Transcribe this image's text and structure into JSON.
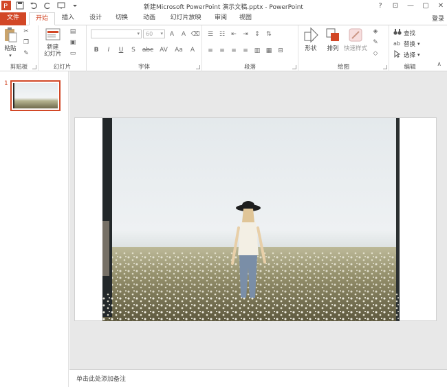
{
  "window": {
    "title": "新建Microsoft PowerPoint 演示文稿.pptx - PowerPoint",
    "controls": [
      "?",
      "⊡",
      "—",
      "▢",
      "✕"
    ]
  },
  "tabs": [
    {
      "label": "文件"
    },
    {
      "label": "开始"
    },
    {
      "label": "插入"
    },
    {
      "label": "设计"
    },
    {
      "label": "切换"
    },
    {
      "label": "动画"
    },
    {
      "label": "幻灯片放映"
    },
    {
      "label": "审阅"
    },
    {
      "label": "视图"
    }
  ],
  "login_label": "登录",
  "ribbon": {
    "clipboard": {
      "group_label": "剪贴板",
      "paste_label": "粘贴"
    },
    "slides": {
      "group_label": "幻灯片",
      "new_slide_label_1": "新建",
      "new_slide_label_2": "幻灯片"
    },
    "font": {
      "group_label": "字体",
      "font_size": "60",
      "format_labels": [
        "B",
        "I",
        "U",
        "S",
        "abc",
        "AV",
        "Aa",
        "A",
        "A"
      ]
    },
    "paragraph": {
      "group_label": "段落"
    },
    "drawing": {
      "group_label": "绘图",
      "shape_label": "形状",
      "arrange_label": "排列",
      "quick_style_label": "快速样式"
    },
    "editing": {
      "group_label": "编辑",
      "find_label": "查找",
      "replace_label": "替换",
      "select_label": "选择"
    }
  },
  "thumbnails": [
    {
      "number": "1"
    }
  ],
  "notes": {
    "placeholder": "单击此处添加备注"
  },
  "colors": {
    "accent": "#d24726",
    "workspace": "#e8e8e8"
  }
}
